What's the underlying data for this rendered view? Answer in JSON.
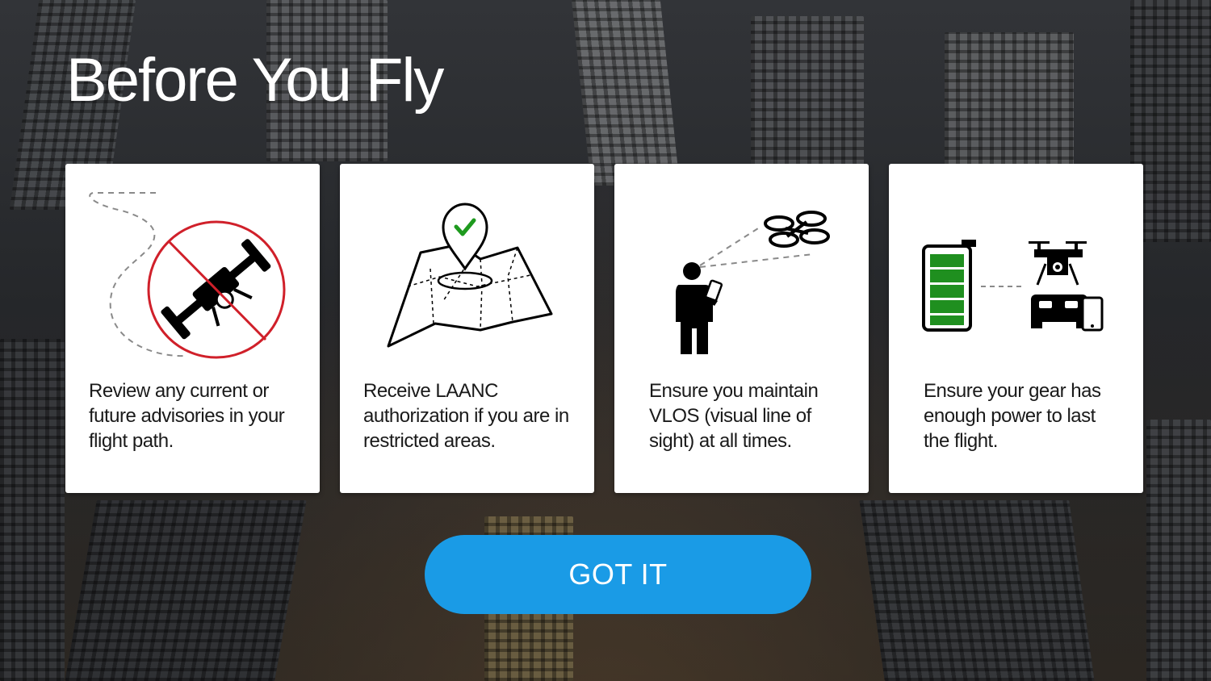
{
  "header": {
    "title": "Before You Fly"
  },
  "cards": [
    {
      "text": "Review any current or future advisories in your flight path.",
      "icon": "no-fly-drone-icon"
    },
    {
      "text": "Receive LAANC authorization if you are in restricted areas.",
      "icon": "map-pin-check-icon"
    },
    {
      "text": "Ensure you maintain VLOS (visual line of sight) at all times.",
      "icon": "pilot-line-of-sight-icon"
    },
    {
      "text": "Ensure your gear has enough power to last the flight.",
      "icon": "battery-and-gear-icon"
    }
  ],
  "actions": {
    "got_it_label": "GOT IT"
  },
  "colors": {
    "accent_button": "#1a9be6",
    "prohibition_red": "#d0202a",
    "check_green": "#1e9a1e",
    "battery_green": "#1f8f1f"
  }
}
